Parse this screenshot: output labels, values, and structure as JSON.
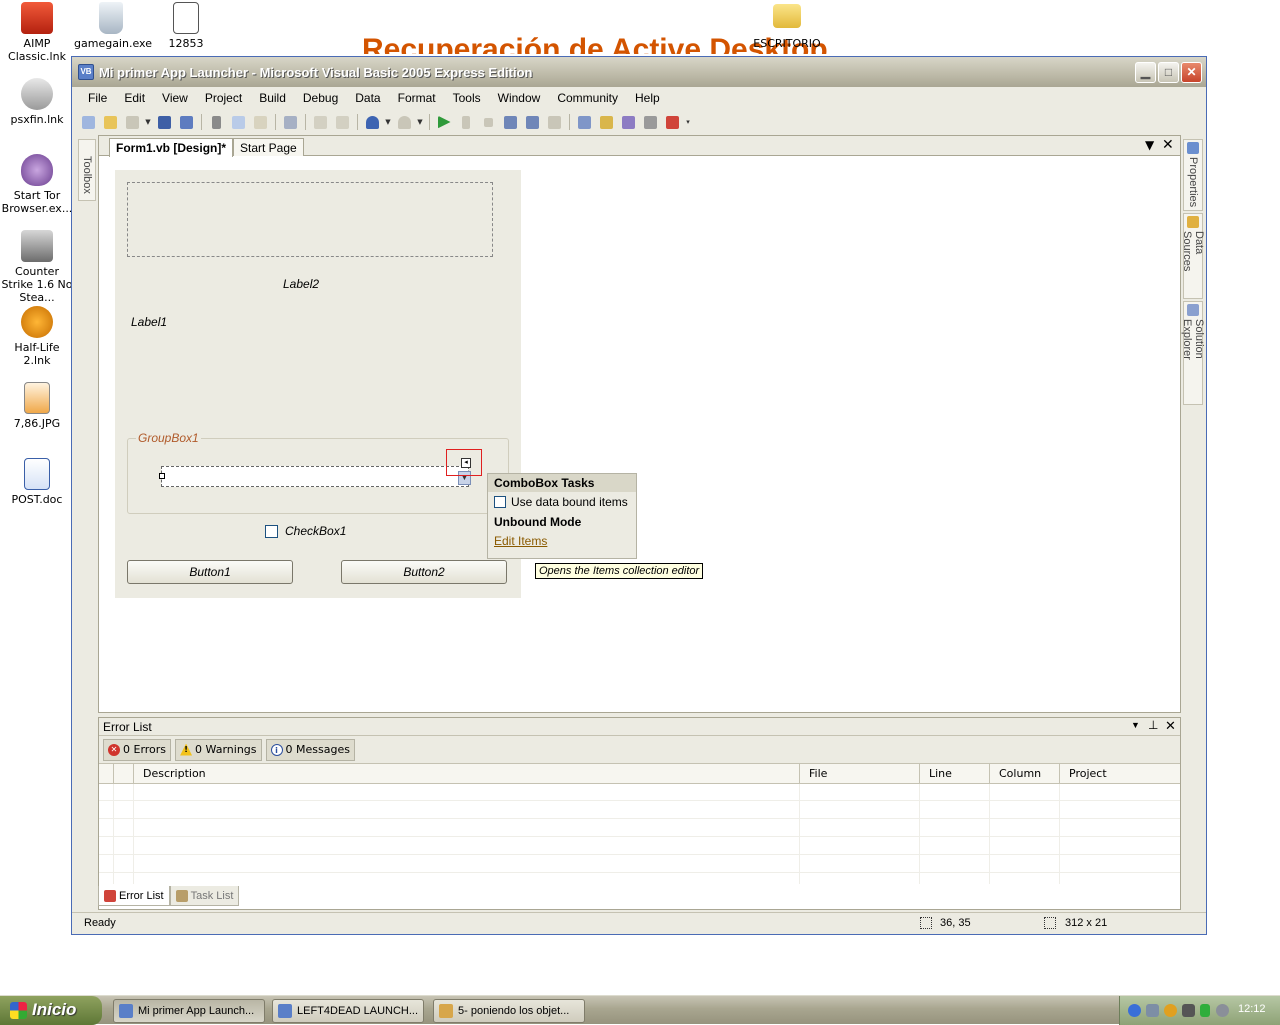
{
  "desktop": {
    "wallpaper_title": "Recuperación de Active Desktop",
    "icons": [
      {
        "label": "AIMP Classic.lnk"
      },
      {
        "label": "gamegain.exe"
      },
      {
        "label": "12853"
      },
      {
        "label": "ESCRITORIO"
      },
      {
        "label": "psxfin.lnk"
      },
      {
        "label": "Start Tor Browser.ex..."
      },
      {
        "label": "Counter Strike 1.6 No Stea..."
      },
      {
        "label": "Half-Life 2.lnk"
      },
      {
        "label": "7,86.JPG"
      },
      {
        "label": "POST.doc"
      }
    ]
  },
  "window": {
    "title": "Mi primer App Launcher - Microsoft Visual Basic 2005 Express Edition",
    "menu": [
      "File",
      "Edit",
      "View",
      "Project",
      "Build",
      "Debug",
      "Data",
      "Format",
      "Tools",
      "Window",
      "Community",
      "Help"
    ]
  },
  "side_panels": {
    "left": "Toolbox",
    "right": [
      "Properties",
      "Data Sources",
      "Solution Explorer"
    ]
  },
  "document_tabs": [
    {
      "label": "Form1.vb [Design]*",
      "active": true
    },
    {
      "label": "Start Page",
      "active": false
    }
  ],
  "form": {
    "label2": "Label2",
    "label1": "Label1",
    "groupbox": "GroupBox1",
    "checkbox": "CheckBox1",
    "button1": "Button1",
    "button2": "Button2"
  },
  "combobox_tasks": {
    "title": "ComboBox Tasks",
    "option_label": "Use data bound items",
    "option_checked": false,
    "section": "Unbound Mode",
    "link": "Edit Items",
    "tooltip": "Opens the Items collection editor"
  },
  "error_list": {
    "title": "Error List",
    "filters": {
      "errors": "0 Errors",
      "warnings": "0 Warnings",
      "messages": "0 Messages"
    },
    "columns": [
      "Description",
      "File",
      "Line",
      "Column",
      "Project"
    ],
    "tabs": [
      "Error List",
      "Task List"
    ]
  },
  "status": {
    "text": "Ready",
    "position": "36, 35",
    "size": "312 x 21"
  },
  "taskbar": {
    "start": "Inicio",
    "buttons": [
      "Mi primer App Launch...",
      "LEFT4DEAD LAUNCH...",
      "5- poniendo los objet..."
    ],
    "clock": "12:12"
  },
  "colors": {
    "accent": "#d35400",
    "window_chrome": "#ecebe2",
    "link": "#8a5a00"
  }
}
